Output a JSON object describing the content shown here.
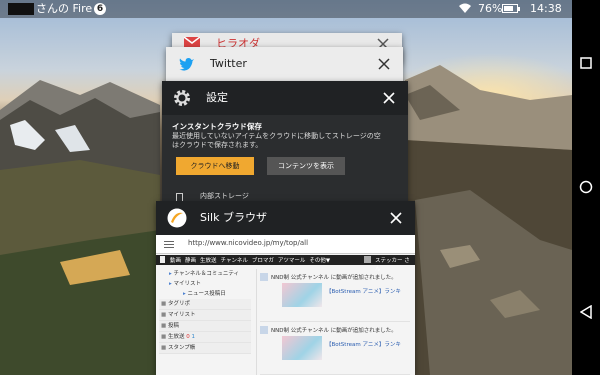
{
  "status_bar": {
    "owner": "さんの Fire",
    "notification_count": "6",
    "battery": "76%",
    "battery_level": 0.76,
    "time": "14:38"
  },
  "recent_apps": [
    {
      "title": "ヒラオダ",
      "icon": "gmail-icon"
    },
    {
      "title": "Twitter",
      "icon": "twitter-icon"
    },
    {
      "title": "設定",
      "icon": "gear-icon"
    },
    {
      "title": "Silk ブラウザ",
      "icon": "silk-icon"
    }
  ],
  "settings_preview": {
    "heading": "インスタントクラウド保存",
    "description": "最近使用していないアイテムをクラウドに移動してストレージの空",
    "description2": "はクラウドで保存されます。",
    "primary_button": "クラウドへ移動",
    "secondary_button": "コンテンツを表示",
    "storage_label": "内部ストレージ"
  },
  "silk_preview": {
    "url": "http://www.nicovideo.jp/my/top/all",
    "nav_items": [
      "動画",
      "静画",
      "生放送",
      "チャンネル",
      "ブロマガ",
      "アツマール",
      "その他▼"
    ],
    "user_label": "ステッカー さん",
    "sidebar": [
      "チャンネル＆コミュニティ",
      "マイリスト",
      "ニュース投稿日",
      "タグリポ",
      "マイリスト",
      "投稿",
      "生放送",
      "スタンプ帳"
    ],
    "live_counts": [
      "0",
      "1"
    ],
    "feed": [
      {
        "text": "NND制 公式チャンネル に動画が追加されました。",
        "sub": "【BotStream アニメ】ランキ"
      },
      {
        "text": "NND制 公式チャンネル に動画が追加されました。",
        "sub": "【BotStream アニメ】ランキ"
      }
    ]
  },
  "colors": {
    "accent": "#f0a830",
    "twitter": "#1da1f2",
    "silk": "#f5a623"
  }
}
